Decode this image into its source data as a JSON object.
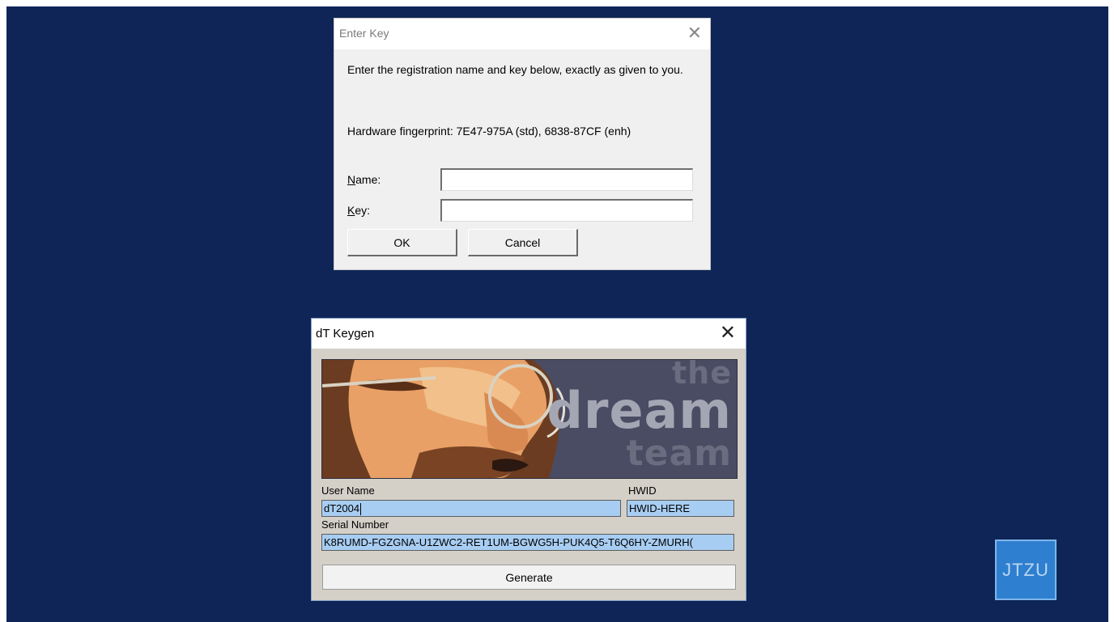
{
  "enter_key_dialog": {
    "title": "Enter Key",
    "instructions": "Enter the registration name and key below, exactly as given to you.",
    "fingerprint": "Hardware fingerprint: 7E47-975A (std), 6838-87CF (enh)",
    "name_label_accel": "N",
    "name_label_rest": "ame:",
    "key_label_accel": "K",
    "key_label_rest": "ey:",
    "name_value": "",
    "key_value": "",
    "ok_label": "OK",
    "cancel_label": "Cancel"
  },
  "keygen_dialog": {
    "title": "dT Keygen",
    "banner_text": [
      "the",
      "dream",
      "team"
    ],
    "user_name_label": "User Name",
    "user_name_value": "dT2004",
    "hwid_label": "HWID",
    "hwid_value": "HWID-HERE",
    "serial_label": "Serial Number",
    "serial_value": "K8RUMD-FGZGNA-U1ZWC2-RET1UM-BGWG5H-PUK4Q5-T6Q6HY-ZMURH(",
    "generate_label": "Generate"
  },
  "watermark": "JTZU",
  "colors": {
    "desktop": "#0f2557",
    "field_highlight": "#a8cdf2",
    "watermark_bg": "#2e7fd0"
  }
}
